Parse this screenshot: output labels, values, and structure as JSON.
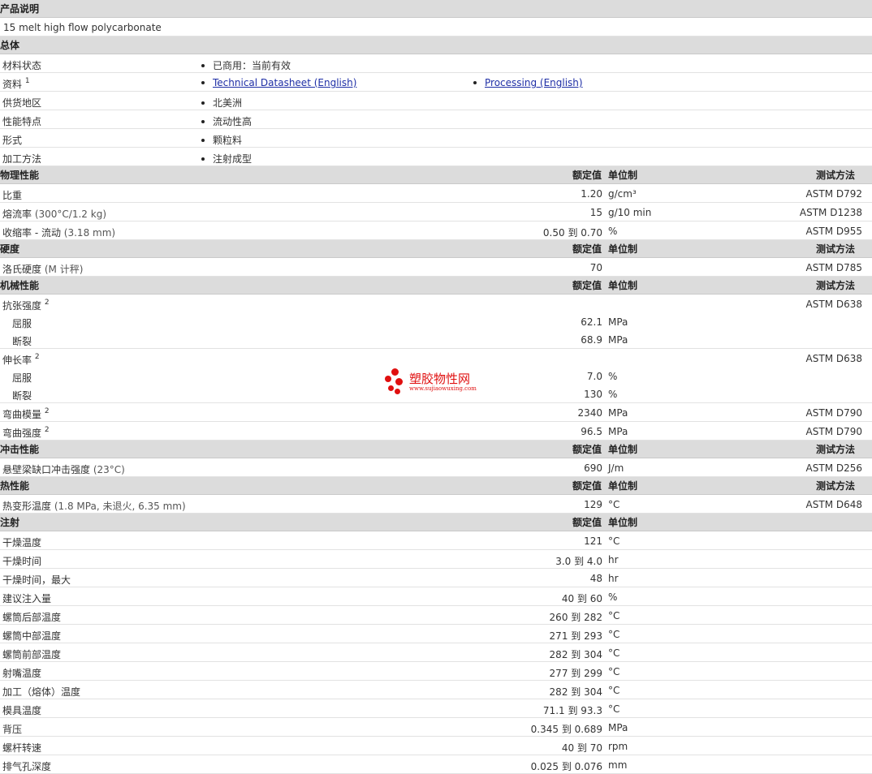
{
  "description": {
    "title": "产品说明",
    "text": "15 melt high flow polycarbonate"
  },
  "general": {
    "title": "总体",
    "rows": [
      {
        "label": "材料状态",
        "b1": "已商用：当前有效"
      },
      {
        "label": "资料",
        "sup": "1",
        "b1": "Technical Datasheet (English)",
        "b2": "Processing (English)"
      },
      {
        "label": "供货地区",
        "b1": "北美洲"
      },
      {
        "label": "性能特点",
        "b1": "流动性高"
      },
      {
        "label": "形式",
        "b1": "颗粒料"
      },
      {
        "label": "加工方法",
        "b1": "注射成型"
      }
    ]
  },
  "headers": {
    "nominal": "额定值",
    "unit": "单位制",
    "method": "测试方法"
  },
  "physical": {
    "title": "物理性能",
    "rows": [
      {
        "label": "比重",
        "value": "1.20",
        "unit": "g/cm³",
        "method": "ASTM D792"
      },
      {
        "label": "熔流率",
        "sub": "(300°C/1.2 kg)",
        "value": "15",
        "unit": "g/10 min",
        "method": "ASTM D1238"
      },
      {
        "label": "收缩率 - 流动",
        "sub": "(3.18 mm)",
        "value": "0.50 到  0.70",
        "unit": "%",
        "method": "ASTM D955"
      }
    ]
  },
  "hardness": {
    "title": "硬度",
    "rows": [
      {
        "label": "洛氏硬度",
        "sub": "(M 计秤)",
        "value": "70",
        "unit": "",
        "method": "ASTM D785"
      }
    ]
  },
  "mechanical": {
    "title": "机械性能",
    "rows": [
      {
        "label": "抗张强度",
        "sup": "2",
        "value": "",
        "unit": "",
        "method": "ASTM D638"
      },
      {
        "label": "屈服",
        "indent": true,
        "value": "62.1",
        "unit": "MPa",
        "method": ""
      },
      {
        "label": "断裂",
        "indent": true,
        "value": "68.9",
        "unit": "MPa",
        "method": ""
      },
      {
        "label": "伸长率",
        "sup": "2",
        "value": "",
        "unit": "",
        "method": "ASTM D638"
      },
      {
        "label": "屈服",
        "indent": true,
        "value": "7.0",
        "unit": "%",
        "method": ""
      },
      {
        "label": "断裂",
        "indent": true,
        "value": "130",
        "unit": "%",
        "method": ""
      },
      {
        "label": "弯曲模量",
        "sup": "2",
        "value": "2340",
        "unit": "MPa",
        "method": "ASTM D790"
      },
      {
        "label": "弯曲强度",
        "sup": "2",
        "value": "96.5",
        "unit": "MPa",
        "method": "ASTM D790"
      }
    ]
  },
  "impact": {
    "title": "冲击性能",
    "rows": [
      {
        "label": "悬壁梁缺口冲击强度",
        "sub": "(23°C)",
        "value": "690",
        "unit": "J/m",
        "method": "ASTM D256"
      }
    ]
  },
  "thermal": {
    "title": "热性能",
    "rows": [
      {
        "label": "热变形温度",
        "sub": "(1.8 MPa, 未退火, 6.35 mm)",
        "value": "129",
        "unit": "°C",
        "method": "ASTM D648"
      }
    ]
  },
  "injection": {
    "title": "注射",
    "rows": [
      {
        "label": "干燥温度",
        "value": "121",
        "unit": "°C"
      },
      {
        "label": "干燥时间",
        "value": "3.0 到  4.0",
        "unit": "hr"
      },
      {
        "label": "干燥时间，最大",
        "value": "48",
        "unit": "hr"
      },
      {
        "label": "建议注入量",
        "value": "40 到  60",
        "unit": "%"
      },
      {
        "label": "螺筒后部温度",
        "value": "260 到  282",
        "unit": "°C"
      },
      {
        "label": "螺筒中部温度",
        "value": "271 到  293",
        "unit": "°C"
      },
      {
        "label": "螺筒前部温度",
        "value": "282 到  304",
        "unit": "°C"
      },
      {
        "label": "射嘴温度",
        "value": "277 到  299",
        "unit": "°C"
      },
      {
        "label": "加工（熔体）温度",
        "value": "282 到  304",
        "unit": "°C"
      },
      {
        "label": "模具温度",
        "value": "71.1 到  93.3",
        "unit": "°C"
      },
      {
        "label": "背压",
        "value": "0.345 到  0.689",
        "unit": "MPa"
      },
      {
        "label": "螺杆转速",
        "value": "40 到  70",
        "unit": "rpm"
      },
      {
        "label": "排气孔深度",
        "value": "0.025 到  0.076",
        "unit": "mm"
      }
    ]
  },
  "watermark": {
    "name": "塑胶物性网",
    "url": "www.sujiaowuxing.com"
  },
  "colors": {
    "section_bg": "#dcdcdc",
    "link": "#1f2fa6",
    "watermark": "#e01010"
  }
}
